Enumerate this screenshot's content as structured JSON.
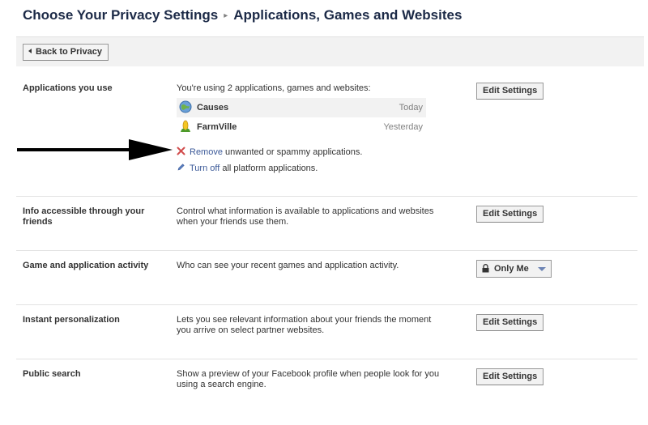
{
  "header": {
    "title": "Choose Your Privacy Settings",
    "separator": "▸",
    "subtitle": "Applications, Games and Websites"
  },
  "toolbar": {
    "back_label": "Back to Privacy"
  },
  "apps_section": {
    "label": "Applications you use",
    "intro": "You're using 2 applications, games and websites:",
    "apps": [
      {
        "name": "Causes",
        "date": "Today",
        "icon": "causes-globe-icon"
      },
      {
        "name": "FarmVille",
        "date": "Yesterday",
        "icon": "farmville-corn-icon"
      }
    ],
    "remove_link": "Remove",
    "remove_text": " unwanted or spammy applications.",
    "turnoff_link": "Turn off",
    "turnoff_text": " all platform applications.",
    "button": "Edit Settings"
  },
  "sections": [
    {
      "label": "Info accessible through your friends",
      "desc": "Control what information is available to applications and websites when your friends use them.",
      "button": "Edit Settings"
    },
    {
      "label": "Game and application activity",
      "desc": "Who can see your recent games and application activity.",
      "select": "Only Me"
    },
    {
      "label": "Instant personalization",
      "desc": "Lets you see relevant information about your friends the moment you arrive on select partner websites.",
      "button": "Edit Settings"
    },
    {
      "label": "Public search",
      "desc": "Show a preview of your Facebook profile when people look for you using a search engine.",
      "button": "Edit Settings"
    }
  ],
  "colors": {
    "heading": "#1c2a47",
    "link": "#3b5998",
    "row_highlight": "#f2f2f2",
    "divider": "#e2e2e2"
  }
}
